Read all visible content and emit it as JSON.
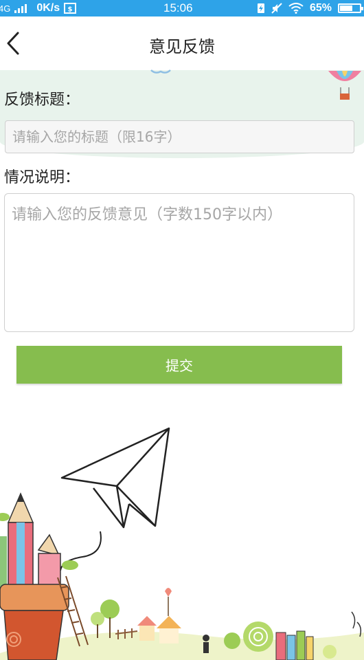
{
  "status_bar": {
    "network": "4G",
    "speed": "0K/s",
    "time": "15:06",
    "battery": "65%",
    "battery_level": 0.65
  },
  "header": {
    "title": "意见反馈"
  },
  "form": {
    "title_label": "反馈标题：",
    "title_placeholder": "请输入您的标题（限16字）",
    "desc_label": "情况说明：",
    "desc_placeholder": "请输入您的反馈意见（字数150字以内）",
    "submit_label": "提交"
  },
  "colors": {
    "status_bar": "#2ea3e8",
    "submit": "#86bd4e"
  }
}
